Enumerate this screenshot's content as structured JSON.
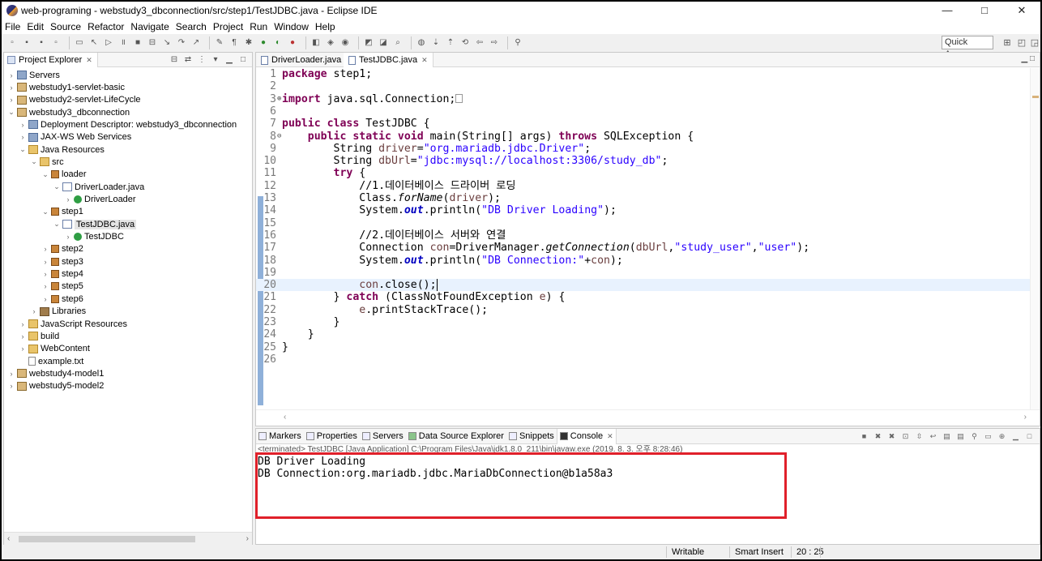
{
  "window": {
    "title": "web-programing - webstudy3_dbconnection/src/step1/TestJDBC.java - Eclipse IDE",
    "minimize_icon": "minimize-icon",
    "maximize_icon": "maximize-icon",
    "close_icon": "close-icon"
  },
  "menu": [
    "File",
    "Edit",
    "Source",
    "Refactor",
    "Navigate",
    "Search",
    "Project",
    "Run",
    "Window",
    "Help"
  ],
  "toolbar": {
    "quick_access": "Quick Access"
  },
  "explorer": {
    "title": "Project Explorer",
    "tree": [
      {
        "label": "Servers",
        "icon": "servers-icon",
        "twisty": "›"
      },
      {
        "label": "webstudy1-servlet-basic",
        "icon": "project-icon",
        "twisty": "›"
      },
      {
        "label": "webstudy2-servlet-LifeCycle",
        "icon": "project-icon",
        "twisty": "›"
      },
      {
        "label": "webstudy3_dbconnection",
        "icon": "project-icon",
        "twisty": "⌄"
      },
      {
        "label": "Deployment Descriptor: webstudy3_dbconnection",
        "icon": "descriptor-icon",
        "twisty": "›"
      },
      {
        "label": "JAX-WS Web Services",
        "icon": "webservices-icon",
        "twisty": "›"
      },
      {
        "label": "Java Resources",
        "icon": "java-resources-icon",
        "twisty": "⌄"
      },
      {
        "label": "src",
        "icon": "source-folder-icon",
        "twisty": "⌄"
      },
      {
        "label": "loader",
        "icon": "package-icon",
        "twisty": "⌄"
      },
      {
        "label": "DriverLoader.java",
        "icon": "java-file-icon",
        "twisty": "⌄"
      },
      {
        "label": "DriverLoader",
        "icon": "class-icon",
        "twisty": "›"
      },
      {
        "label": "step1",
        "icon": "package-icon",
        "twisty": "⌄"
      },
      {
        "label": "TestJDBC.java",
        "icon": "java-file-icon",
        "twisty": "⌄"
      },
      {
        "label": "TestJDBC",
        "icon": "class-icon",
        "twisty": "›"
      },
      {
        "label": "step2",
        "icon": "package-icon",
        "twisty": "›"
      },
      {
        "label": "step3",
        "icon": "package-icon",
        "twisty": "›"
      },
      {
        "label": "step4",
        "icon": "package-icon",
        "twisty": "›"
      },
      {
        "label": "step5",
        "icon": "package-icon",
        "twisty": "›"
      },
      {
        "label": "step6",
        "icon": "package-icon",
        "twisty": "›"
      },
      {
        "label": "Libraries",
        "icon": "library-icon",
        "twisty": "›"
      },
      {
        "label": "JavaScript Resources",
        "icon": "javascript-resources-icon",
        "twisty": "›"
      },
      {
        "label": "build",
        "icon": "folder-icon",
        "twisty": "›"
      },
      {
        "label": "WebContent",
        "icon": "folder-icon",
        "twisty": "›"
      },
      {
        "label": "example.txt",
        "icon": "text-file-icon",
        "twisty": ""
      },
      {
        "label": "webstudy4-model1",
        "icon": "project-icon",
        "twisty": "›"
      },
      {
        "label": "webstudy5-model2",
        "icon": "project-icon",
        "twisty": "›"
      }
    ]
  },
  "editor": {
    "tabs": [
      {
        "label": "DriverLoader.java",
        "active": false
      },
      {
        "label": "TestJDBC.java",
        "active": true
      }
    ],
    "current_line": 20,
    "lines": [
      {
        "n": "1",
        "marker": ""
      },
      {
        "n": "2",
        "marker": ""
      },
      {
        "n": "3",
        "marker": "⊕"
      },
      {
        "n": "6",
        "marker": ""
      },
      {
        "n": "7",
        "marker": ""
      },
      {
        "n": "8",
        "marker": "⊖"
      },
      {
        "n": "9",
        "marker": ""
      },
      {
        "n": "10",
        "marker": ""
      },
      {
        "n": "11",
        "marker": ""
      },
      {
        "n": "12",
        "marker": ""
      },
      {
        "n": "13",
        "marker": ""
      },
      {
        "n": "14",
        "marker": ""
      },
      {
        "n": "15",
        "marker": ""
      },
      {
        "n": "16",
        "marker": ""
      },
      {
        "n": "17",
        "marker": ""
      },
      {
        "n": "18",
        "marker": ""
      },
      {
        "n": "19",
        "marker": ""
      },
      {
        "n": "20",
        "marker": ""
      },
      {
        "n": "21",
        "marker": ""
      },
      {
        "n": "22",
        "marker": ""
      },
      {
        "n": "23",
        "marker": ""
      },
      {
        "n": "24",
        "marker": ""
      },
      {
        "n": "25",
        "marker": ""
      },
      {
        "n": "26",
        "marker": ""
      }
    ],
    "code": {
      "l1_kw": "package",
      "l1_rest": " step1;",
      "l3_kw": "import",
      "l3_rest": " java.sql.Connection;",
      "l7_kw": "public class",
      "l7_rest": " TestJDBC {",
      "l8_kw1": "    public static void",
      "l8_mid": " main(String[] args) ",
      "l8_kw2": "throws",
      "l8_rest": " SQLException {",
      "l9_a": "        String ",
      "l9_var": "driver",
      "l9_eq": "=",
      "l9_str": "\"org.mariadb.jdbc.Driver\"",
      "l9_end": ";",
      "l10_a": "        String ",
      "l10_var": "dbUrl",
      "l10_eq": "=",
      "l10_str": "\"jdbc:mysql://localhost:3306/study_db\"",
      "l10_end": ";",
      "l11_kw": "        try",
      "l11_rest": " {",
      "l12_cm": "            //1.데이터베이스 드라이버 로딩",
      "l13_a": "            Class.",
      "l13_it": "forName",
      "l13_b": "(",
      "l13_var": "driver",
      "l13_c": ");",
      "l14_a": "            System.",
      "l14_out": "out",
      "l14_b": ".println(",
      "l14_str": "\"DB Driver Loading\"",
      "l14_c": ");",
      "l16_cm": "            //2.데이터베이스 서버와 연결",
      "l17_a": "            Connection ",
      "l17_var": "con",
      "l17_b": "=DriverManager.",
      "l17_it": "getConnection",
      "l17_c": "(",
      "l17_var2": "dbUrl",
      "l17_d": ",",
      "l17_s1": "\"study_user\"",
      "l17_e": ",",
      "l17_s2": "\"user\"",
      "l17_f": ");",
      "l18_a": "            System.",
      "l18_out": "out",
      "l18_b": ".println(",
      "l18_str": "\"DB Connection:\"",
      "l18_c": "+",
      "l18_var": "con",
      "l18_d": ");",
      "l20_a": "            ",
      "l20_var": "con",
      "l20_b": ".close();",
      "l21_a": "        } ",
      "l21_kw": "catch",
      "l21_b": " (ClassNotFoundException ",
      "l21_var": "e",
      "l21_c": ") {",
      "l22_a": "            ",
      "l22_var": "e",
      "l22_b": ".printStackTrace();",
      "l23": "        }",
      "l24": "    }",
      "l25": "}"
    }
  },
  "console": {
    "tabs": [
      "Markers",
      "Properties",
      "Servers",
      "Data Source Explorer",
      "Snippets",
      "Console"
    ],
    "active_tab": "Console",
    "terminated": "<terminated> TestJDBC [Java Application] C:\\Program Files\\Java\\jdk1.8.0_211\\bin\\javaw.exe (2019. 8. 3. 오후 8:28:46)",
    "output": [
      "DB Driver Loading",
      "DB Connection:org.mariadb.jdbc.MariaDbConnection@b1a58a3"
    ],
    "highlight_color": "#e0202a"
  },
  "status": {
    "writable": "Writable",
    "insert_mode": "Smart Insert",
    "position": "20 : 25"
  }
}
